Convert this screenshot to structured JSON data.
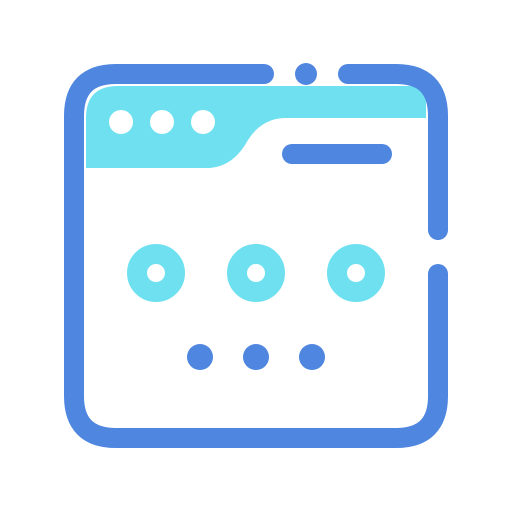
{
  "icon": {
    "name": "browser-window-password-icon",
    "colors": {
      "outline": "#4F86E0",
      "accent": "#6FE0F0",
      "background": "#FFFFFF"
    },
    "elements": {
      "window_controls": [
        "dot",
        "dot",
        "dot"
      ],
      "password_circles": [
        "ring",
        "ring",
        "ring"
      ],
      "password_dots": [
        "dot",
        "dot",
        "dot"
      ]
    }
  }
}
